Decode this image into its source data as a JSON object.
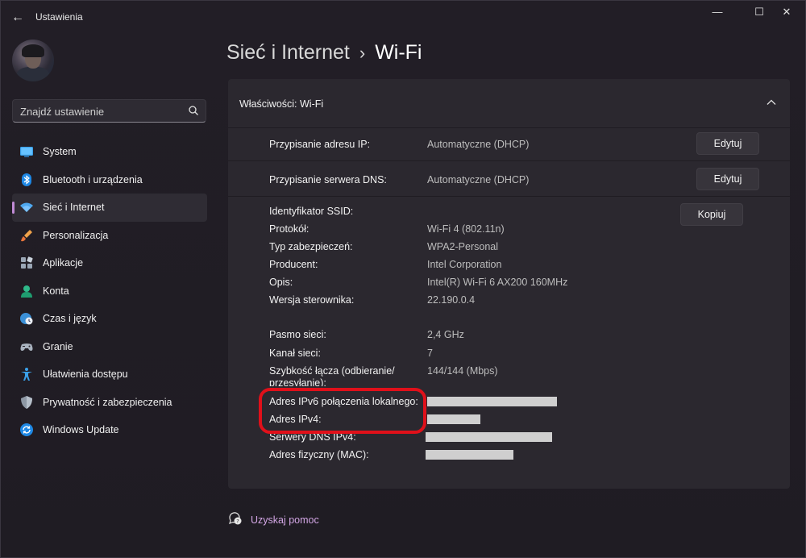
{
  "window": {
    "app_title": "Ustawienia",
    "controls": {
      "minimize": "—",
      "maximize": "☐",
      "close": "✕"
    }
  },
  "sidebar": {
    "search_placeholder": "Znajdź ustawienie",
    "items": [
      {
        "label": "System",
        "icon": "monitor-icon",
        "active": false
      },
      {
        "label": "Bluetooth i urządzenia",
        "icon": "bluetooth-icon",
        "active": false
      },
      {
        "label": "Sieć i Internet",
        "icon": "wifi-icon",
        "active": true
      },
      {
        "label": "Personalizacja",
        "icon": "brush-icon",
        "active": false
      },
      {
        "label": "Aplikacje",
        "icon": "apps-icon",
        "active": false
      },
      {
        "label": "Konta",
        "icon": "person-icon",
        "active": false
      },
      {
        "label": "Czas i język",
        "icon": "globe-clock-icon",
        "active": false
      },
      {
        "label": "Granie",
        "icon": "gamepad-icon",
        "active": false
      },
      {
        "label": "Ułatwienia dostępu",
        "icon": "accessibility-icon",
        "active": false
      },
      {
        "label": "Prywatność i zabezpieczenia",
        "icon": "shield-icon",
        "active": false
      },
      {
        "label": "Windows Update",
        "icon": "update-icon",
        "active": false
      }
    ]
  },
  "breadcrumb": {
    "parent": "Sieć i Internet",
    "separator": "›",
    "current": "Wi-Fi"
  },
  "panel": {
    "title": "Właściwości: Wi-Fi",
    "ip_assignment": {
      "label": "Przypisanie adresu IP:",
      "value": "Automatyczne (DHCP)",
      "button": "Edytuj"
    },
    "dns_assignment": {
      "label": "Przypisanie serwera DNS:",
      "value": "Automatyczne (DHCP)",
      "button": "Edytuj"
    },
    "copy_button": "Kopiuj",
    "properties": [
      {
        "label": "Identyfikator SSID:",
        "value": ""
      },
      {
        "label": "Protokół:",
        "value": "Wi-Fi 4 (802.11n)"
      },
      {
        "label": "Typ zabezpieczeń:",
        "value": "WPA2-Personal"
      },
      {
        "label": "Producent:",
        "value": "Intel Corporation"
      },
      {
        "label": "Opis:",
        "value": "Intel(R) Wi-Fi 6 AX200 160MHz"
      },
      {
        "label": "Wersja sterownika:",
        "value": "22.190.0.4"
      },
      {
        "label": "Pasmo sieci:",
        "value": "2,4 GHz"
      },
      {
        "label": "Kanał sieci:",
        "value": "7"
      },
      {
        "label": "Szybkość łącza (odbieranie/ przesyłanie):",
        "value": "144/144 (Mbps)"
      },
      {
        "label": "Adres IPv6 połączenia lokalnego:",
        "value": ""
      },
      {
        "label": "Adres IPv4:",
        "value": ""
      },
      {
        "label": "Serwery DNS IPv4:",
        "value": ""
      },
      {
        "label": "Adres fizyczny (MAC):",
        "value": ""
      }
    ]
  },
  "help": {
    "label": "Uzyskaj pomoc"
  },
  "colors": {
    "accent": "#c18bd6",
    "highlight": "#e0101a",
    "link": "#d3a6e5"
  }
}
